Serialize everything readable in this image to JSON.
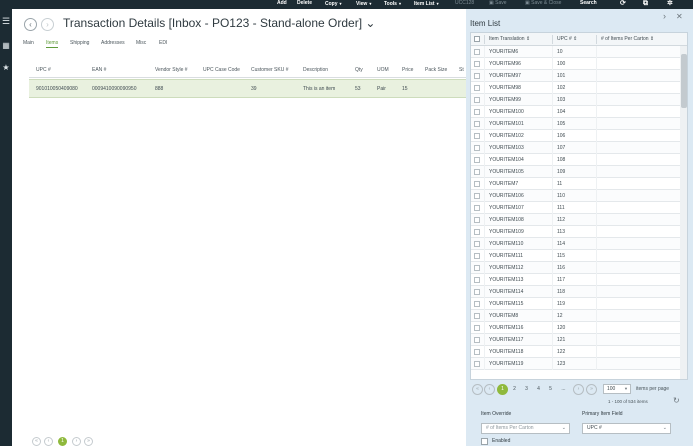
{
  "toolbar": {
    "add": "Add",
    "delete": "Delete",
    "copy": "Copy",
    "view": "View",
    "tools": "Tools",
    "item_list": "Item List",
    "ucc128": "UCC128",
    "save": "Save",
    "save_close": "Save & Close",
    "search": "Search"
  },
  "page": {
    "title": "Transaction Details [Inbox - PO123 - Stand-alone Order]",
    "title_chevron": "⌄"
  },
  "tabs": [
    "Main",
    "Items",
    "Shipping",
    "Addresses",
    "Misc",
    "EDI"
  ],
  "grid": {
    "columns": [
      "UPC #",
      "EAN #",
      "Vendor Style #",
      "UPC Case Code",
      "Customer SKU #",
      "Description",
      "Qty",
      "UOM",
      "Price",
      "Pack Size",
      "St"
    ],
    "row": [
      "901010050409080",
      "0009410090090950",
      "888",
      "",
      "39",
      "This is an item",
      "53",
      "Pair",
      "15",
      "",
      ""
    ]
  },
  "main_pager": {
    "prev_first": "«",
    "prev": "‹",
    "page": "1",
    "next": "›",
    "next_last": "»"
  },
  "item_list": {
    "title": "Item List",
    "columns": [
      "Item Translation ⇕",
      "UPC # ⇕",
      "# of Items Per Carton ⇕"
    ],
    "rows": [
      [
        "YOURITEM6",
        "10"
      ],
      [
        "YOURITEM96",
        "100"
      ],
      [
        "YOURITEM97",
        "101"
      ],
      [
        "YOURITEM98",
        "102"
      ],
      [
        "YOURITEM99",
        "103"
      ],
      [
        "YOURITEM100",
        "104"
      ],
      [
        "YOURITEM101",
        "105"
      ],
      [
        "YOURITEM102",
        "106"
      ],
      [
        "YOURITEM103",
        "107"
      ],
      [
        "YOURITEM104",
        "108"
      ],
      [
        "YOURITEM105",
        "109"
      ],
      [
        "YOURITEM7",
        "11"
      ],
      [
        "YOURITEM106",
        "110"
      ],
      [
        "YOURITEM107",
        "111"
      ],
      [
        "YOURITEM108",
        "112"
      ],
      [
        "YOURITEM109",
        "113"
      ],
      [
        "YOURITEM110",
        "114"
      ],
      [
        "YOURITEM111",
        "115"
      ],
      [
        "YOURITEM112",
        "116"
      ],
      [
        "YOURITEM113",
        "117"
      ],
      [
        "YOURITEM114",
        "118"
      ],
      [
        "YOURITEM115",
        "119"
      ],
      [
        "YOURITEM8",
        "12"
      ],
      [
        "YOURITEM116",
        "120"
      ],
      [
        "YOURITEM117",
        "121"
      ],
      [
        "YOURITEM118",
        "122"
      ],
      [
        "YOURITEM119",
        "123"
      ]
    ],
    "pager": {
      "pages": [
        "1",
        "2",
        "3",
        "4",
        "5",
        "..."
      ],
      "per_page_value": "100",
      "per_page_label": "items per page",
      "summary": "1 - 100 of 534 items"
    },
    "item_override_label": "Item Override",
    "item_override_placeholder": "# of Items Per Carton",
    "primary_field_label": "Primary Item Field",
    "primary_field_value": "UPC #",
    "enabled_label": "Enabled"
  }
}
